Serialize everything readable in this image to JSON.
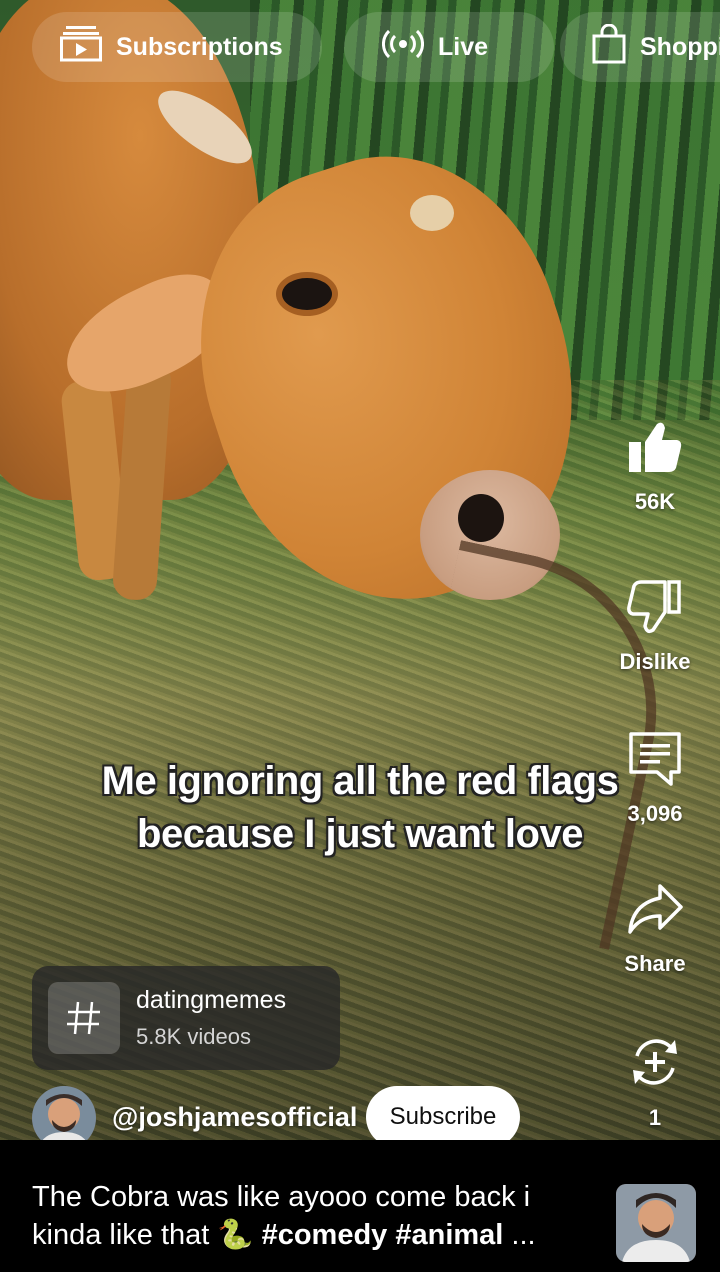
{
  "top_nav": {
    "subscriptions": "Subscriptions",
    "live": "Live",
    "shopping": "Shopping"
  },
  "actions": {
    "like_count": "56K",
    "dislike": "Dislike",
    "comment_count": "3,096",
    "share": "Share",
    "remix_count": "1"
  },
  "caption": "Me ignoring all the red flags because I just want love",
  "hashtag_card": {
    "tag": "datingmemes",
    "count": "5.8K videos"
  },
  "channel": {
    "handle": "@joshjamesofficial",
    "subscribe": "Subscribe"
  },
  "description": {
    "text": "The Cobra was like ayooo come back i kinda like that 🐍",
    "tags": "#comedy #animal",
    "ellipsis": "..."
  },
  "icons": [
    "subscriptions-icon",
    "live-icon",
    "shopping-bag-icon",
    "like-icon",
    "dislike-icon",
    "comment-icon",
    "share-icon",
    "remix-icon",
    "hashtag-icon"
  ]
}
